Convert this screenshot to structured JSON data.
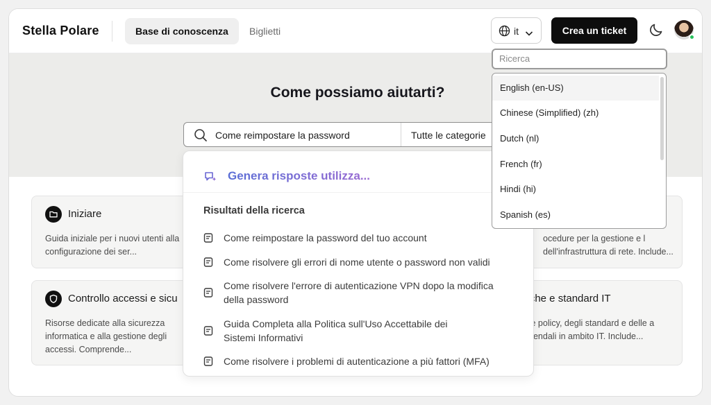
{
  "header": {
    "logo": "Stella Polare",
    "tabs": [
      {
        "label": "Base di conoscenza",
        "active": true
      },
      {
        "label": "Biglietti",
        "active": false
      }
    ],
    "language_code": "it",
    "create_ticket_label": "Crea un ticket",
    "icons": {
      "language": "globe-icon",
      "chevron": "chevron-down-icon",
      "theme": "moon-icon"
    }
  },
  "hero": {
    "title": "Come possiamo aiutarti?",
    "search_query": "Come reimpostare la password",
    "category": "Tutte le categorie"
  },
  "cards": [
    {
      "title": "Iniziare",
      "description": "Guida iniziale per i nuovi utenti alla configurazione dei ser...",
      "icon": "folder-icon"
    },
    {
      "title": "",
      "description": "ocedure per la gestione e l dell'infrastruttura di rete. Include...",
      "icon": ""
    },
    {
      "title": "Controllo accessi e sicu",
      "description": "Risorse dedicate alla sicurezza informatica e alla gestione degli accessi. Comprende...",
      "icon": "shield-icon"
    },
    {
      "title": "itiche e standard IT",
      "description": "elle policy, degli standard e delle a aziendali in ambito IT. Include...",
      "icon": ""
    }
  ],
  "search_results": {
    "ai_label": "Genera risposte utilizza...",
    "header": "Risultati della ricerca",
    "items": [
      "Come reimpostare la password del tuo account",
      "Come risolvere gli errori di nome utente o password non validi",
      "Come risolvere l'errore di autenticazione VPN dopo la modifica della password",
      "Guida Completa alla Politica sull'Uso Accettabile dei Sistemi Informativi",
      "Come risolvere i problemi di autenticazione a più fattori (MFA)"
    ]
  },
  "language_menu": {
    "search_placeholder": "Ricerca",
    "options": [
      "English (en-US)",
      "Chinese (Simplified) (zh)",
      "Dutch (nl)",
      "French (fr)",
      "Hindi (hi)",
      "Spanish (es)"
    ],
    "highlighted": 0
  },
  "colors": {
    "accent_dark": "#0d0d0d",
    "ai_gradient_start": "#5b6fd6",
    "ai_gradient_end": "#9a6ad2",
    "online": "#27c15c"
  }
}
